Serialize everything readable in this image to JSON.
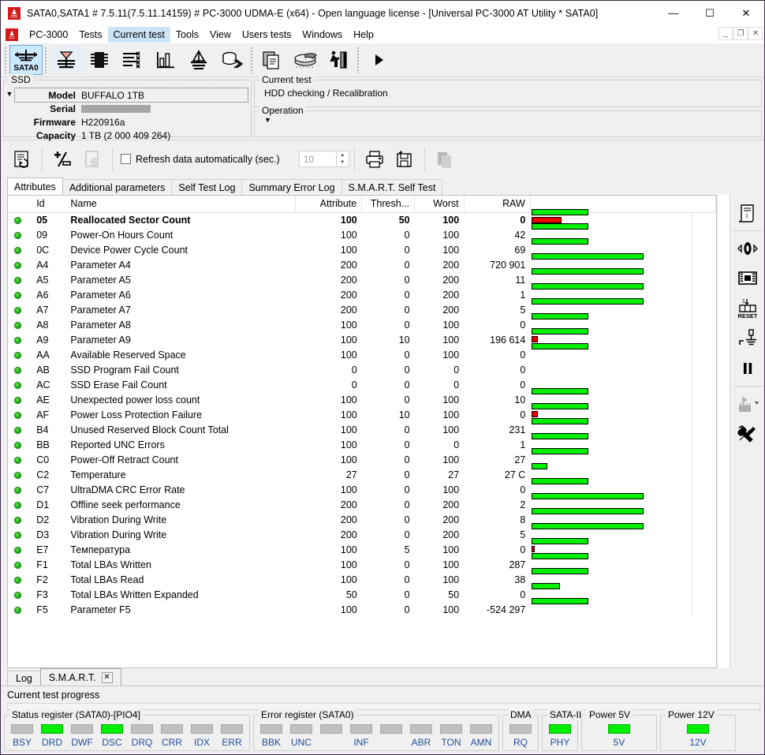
{
  "window": {
    "title": "SATA0,SATA1 # 7.5.11(7.5.11.14159) # PC-3000 UDMA-E (x64) - Open language license - [Universal PC-3000 AT Utility * SATA0]",
    "minimize": "—",
    "maximize": "☐",
    "close": "✕",
    "mdi_minimize": "_",
    "mdi_restore": "❐",
    "mdi_close": "✕"
  },
  "menu": {
    "items": [
      {
        "label": "PC-3000",
        "active": false
      },
      {
        "label": "Tests",
        "active": false
      },
      {
        "label": "Current test",
        "active": true
      },
      {
        "label": "Tools",
        "active": false
      },
      {
        "label": "View",
        "active": false
      },
      {
        "label": "Users tests",
        "active": false
      },
      {
        "label": "Windows",
        "active": false
      },
      {
        "label": "Help",
        "active": false
      }
    ]
  },
  "toolbar": {
    "port_label": "SATA0",
    "buttons": [
      {
        "name": "port-sata0-button",
        "state": "selected"
      },
      {
        "name": "drive-init-button",
        "state": "light"
      },
      {
        "name": "memory-chip-button",
        "state": "normal"
      },
      {
        "name": "list-tests-button",
        "state": "normal"
      },
      {
        "name": "chart-button",
        "state": "normal"
      },
      {
        "name": "heads-button",
        "state": "normal"
      },
      {
        "name": "disk-export-button",
        "state": "normal"
      },
      {
        "name": "copy-button",
        "state": "normal"
      },
      {
        "name": "platters-button",
        "state": "normal"
      },
      {
        "name": "run-person-button",
        "state": "normal"
      },
      {
        "name": "play-button",
        "state": "normal"
      }
    ]
  },
  "drive": {
    "group_label": "SSD",
    "fields": [
      {
        "label": "Model",
        "value": "BUFFALO 1TB",
        "redacted": false
      },
      {
        "label": "Serial",
        "value": "",
        "redacted": true
      },
      {
        "label": "Firmware",
        "value": "H220916a",
        "redacted": false
      },
      {
        "label": "Capacity",
        "value": "1 TB (2 000 409 264)",
        "redacted": false
      }
    ]
  },
  "current_test": {
    "group_label": "Current test",
    "value": "HDD checking / Recalibration"
  },
  "operation": {
    "group_label": "Operation",
    "value": ""
  },
  "panel_toolbar": {
    "refresh_checkbox_label": "Refresh data automatically (sec.)",
    "refresh_checked": false,
    "interval_value": "10",
    "buttons": [
      {
        "name": "refresh-smart-button"
      },
      {
        "name": "clear-smart-button"
      },
      {
        "name": "save-report-button"
      },
      {
        "name": "print-button"
      },
      {
        "name": "save-to-file-button"
      },
      {
        "name": "copy-table-button"
      }
    ]
  },
  "tabs": [
    {
      "label": "Attributes",
      "active": true
    },
    {
      "label": "Additional parameters",
      "active": false
    },
    {
      "label": "Self Test Log",
      "active": false
    },
    {
      "label": "Summary Error Log",
      "active": false
    },
    {
      "label": "S.M.A.R.T. Self Test",
      "active": false
    }
  ],
  "table": {
    "headers": [
      "",
      "Id",
      "Name",
      "Attribute",
      "Thresh...",
      "Worst",
      "RAW",
      ""
    ],
    "rows": [
      {
        "status": "ok",
        "id": "05",
        "name": "Reallocated Sector Count",
        "attribute": "100",
        "threshold": "50",
        "worst": "100",
        "raw": "0",
        "bold": true,
        "green_w": 72,
        "red_w": 38
      },
      {
        "status": "ok",
        "id": "09",
        "name": "Power-On Hours Count",
        "attribute": "100",
        "threshold": "0",
        "worst": "100",
        "raw": "42",
        "bold": false,
        "green_w": 72,
        "red_w": 0
      },
      {
        "status": "ok",
        "id": "0C",
        "name": "Device Power Cycle Count",
        "attribute": "100",
        "threshold": "0",
        "worst": "100",
        "raw": "69",
        "bold": false,
        "green_w": 72,
        "red_w": 0
      },
      {
        "status": "ok",
        "id": "A4",
        "name": "Parameter A4",
        "attribute": "200",
        "threshold": "0",
        "worst": "200",
        "raw": "720 901",
        "bold": false,
        "green_w": 142,
        "red_w": 0
      },
      {
        "status": "ok",
        "id": "A5",
        "name": "Parameter A5",
        "attribute": "200",
        "threshold": "0",
        "worst": "200",
        "raw": "11",
        "bold": false,
        "green_w": 142,
        "red_w": 0
      },
      {
        "status": "ok",
        "id": "A6",
        "name": "Parameter A6",
        "attribute": "200",
        "threshold": "0",
        "worst": "200",
        "raw": "1",
        "bold": false,
        "green_w": 142,
        "red_w": 0
      },
      {
        "status": "ok",
        "id": "A7",
        "name": "Parameter A7",
        "attribute": "200",
        "threshold": "0",
        "worst": "200",
        "raw": "5",
        "bold": false,
        "green_w": 142,
        "red_w": 0
      },
      {
        "status": "ok",
        "id": "A8",
        "name": "Parameter A8",
        "attribute": "100",
        "threshold": "0",
        "worst": "100",
        "raw": "0",
        "bold": false,
        "green_w": 72,
        "red_w": 0
      },
      {
        "status": "ok",
        "id": "A9",
        "name": "Parameter A9",
        "attribute": "100",
        "threshold": "10",
        "worst": "100",
        "raw": "196 614",
        "bold": false,
        "green_w": 72,
        "red_w": 8
      },
      {
        "status": "ok",
        "id": "AA",
        "name": "Available Reserved Space",
        "attribute": "100",
        "threshold": "0",
        "worst": "100",
        "raw": "0",
        "bold": false,
        "green_w": 72,
        "red_w": 0
      },
      {
        "status": "ok",
        "id": "AB",
        "name": "SSD Program Fail Count",
        "attribute": "0",
        "threshold": "0",
        "worst": "0",
        "raw": "0",
        "bold": false,
        "green_w": 0,
        "red_w": 0
      },
      {
        "status": "ok",
        "id": "AC",
        "name": "SSD Erase Fail Count",
        "attribute": "0",
        "threshold": "0",
        "worst": "0",
        "raw": "0",
        "bold": false,
        "green_w": 0,
        "red_w": 0
      },
      {
        "status": "ok",
        "id": "AE",
        "name": "Unexpected power loss count",
        "attribute": "100",
        "threshold": "0",
        "worst": "100",
        "raw": "10",
        "bold": false,
        "green_w": 72,
        "red_w": 0
      },
      {
        "status": "ok",
        "id": "AF",
        "name": "Power Loss Protection Failure",
        "attribute": "100",
        "threshold": "10",
        "worst": "100",
        "raw": "0",
        "bold": false,
        "green_w": 72,
        "red_w": 8
      },
      {
        "status": "ok",
        "id": "B4",
        "name": "Unused Reserved Block Count Total",
        "attribute": "100",
        "threshold": "0",
        "worst": "100",
        "raw": "231",
        "bold": false,
        "green_w": 72,
        "red_w": 0
      },
      {
        "status": "ok",
        "id": "BB",
        "name": "Reported UNC Errors",
        "attribute": "100",
        "threshold": "0",
        "worst": "0",
        "raw": "1",
        "bold": false,
        "green_w": 72,
        "red_w": 0
      },
      {
        "status": "ok",
        "id": "C0",
        "name": "Power-Off Retract Count",
        "attribute": "100",
        "threshold": "0",
        "worst": "100",
        "raw": "27",
        "bold": false,
        "green_w": 72,
        "red_w": 0
      },
      {
        "status": "ok",
        "id": "C2",
        "name": "Temperature",
        "attribute": "27",
        "threshold": "0",
        "worst": "27",
        "raw": "27 C",
        "bold": false,
        "green_w": 20,
        "red_w": 0
      },
      {
        "status": "ok",
        "id": "C7",
        "name": "UltraDMA CRC Error Rate",
        "attribute": "100",
        "threshold": "0",
        "worst": "100",
        "raw": "0",
        "bold": false,
        "green_w": 72,
        "red_w": 0
      },
      {
        "status": "ok",
        "id": "D1",
        "name": "Offline seek performance",
        "attribute": "200",
        "threshold": "0",
        "worst": "200",
        "raw": "2",
        "bold": false,
        "green_w": 142,
        "red_w": 0
      },
      {
        "status": "ok",
        "id": "D2",
        "name": "Vibration During Write",
        "attribute": "200",
        "threshold": "0",
        "worst": "200",
        "raw": "8",
        "bold": false,
        "green_w": 142,
        "red_w": 0
      },
      {
        "status": "ok",
        "id": "D3",
        "name": "Vibration During Write",
        "attribute": "200",
        "threshold": "0",
        "worst": "200",
        "raw": "5",
        "bold": false,
        "green_w": 142,
        "red_w": 0
      },
      {
        "status": "ok",
        "id": "E7",
        "name": "Температура",
        "attribute": "100",
        "threshold": "5",
        "worst": "100",
        "raw": "0",
        "bold": false,
        "green_w": 72,
        "red_w": 4
      },
      {
        "status": "ok",
        "id": "F1",
        "name": "Total LBAs Written",
        "attribute": "100",
        "threshold": "0",
        "worst": "100",
        "raw": "287",
        "bold": false,
        "green_w": 72,
        "red_w": 0
      },
      {
        "status": "ok",
        "id": "F2",
        "name": "Total LBAs Read",
        "attribute": "100",
        "threshold": "0",
        "worst": "100",
        "raw": "38",
        "bold": false,
        "green_w": 72,
        "red_w": 0
      },
      {
        "status": "ok",
        "id": "F3",
        "name": "Total LBAs Written Expanded",
        "attribute": "50",
        "threshold": "0",
        "worst": "50",
        "raw": "0",
        "bold": false,
        "green_w": 36,
        "red_w": 0
      },
      {
        "status": "ok",
        "id": "F5",
        "name": "Parameter F5",
        "attribute": "100",
        "threshold": "0",
        "worst": "100",
        "raw": "-524 297",
        "bold": false,
        "green_w": 72,
        "red_w": 0
      }
    ]
  },
  "right_toolbar": {
    "buttons": [
      {
        "name": "log-info-icon"
      },
      {
        "name": "power-toggle-icon"
      },
      {
        "name": "pcb-board-icon"
      },
      {
        "name": "counter-reset-icon"
      },
      {
        "name": "signal-probe-icon"
      },
      {
        "name": "pause-icon"
      },
      {
        "name": "run-chip-icon"
      },
      {
        "name": "tools-icon"
      }
    ]
  },
  "bottom_tabs": [
    {
      "label": "Log",
      "active": false,
      "closable": false
    },
    {
      "label": "S.M.A.R.T.",
      "active": true,
      "closable": true,
      "close_glyph": "✕"
    }
  ],
  "progress": {
    "label": "Current test progress",
    "percent": 0
  },
  "registers": {
    "status": {
      "legend": "Status register (SATA0)-[PIO4]",
      "leds": [
        {
          "name": "BSY",
          "on": false
        },
        {
          "name": "DRD",
          "on": true
        },
        {
          "name": "DWF",
          "on": false
        },
        {
          "name": "DSC",
          "on": true
        },
        {
          "name": "DRQ",
          "on": false
        },
        {
          "name": "CRR",
          "on": false
        },
        {
          "name": "IDX",
          "on": false
        },
        {
          "name": "ERR",
          "on": false
        }
      ]
    },
    "error": {
      "legend": "Error register (SATA0)",
      "leds": [
        {
          "name": "BBK",
          "on": false
        },
        {
          "name": "UNC",
          "on": false
        },
        {
          "name": "",
          "on": false
        },
        {
          "name": "INF",
          "on": false
        },
        {
          "name": "",
          "on": false
        },
        {
          "name": "ABR",
          "on": false
        },
        {
          "name": "TON",
          "on": false
        },
        {
          "name": "AMN",
          "on": false
        }
      ]
    },
    "dma": {
      "legend": "DMA",
      "leds": [
        {
          "name": "RQ",
          "on": false
        }
      ]
    },
    "sata": {
      "legend": "SATA-II",
      "leds": [
        {
          "name": "PHY",
          "on": true
        }
      ]
    },
    "power5": {
      "legend": "Power 5V",
      "leds": [
        {
          "name": "5V",
          "on": true
        }
      ]
    },
    "power12": {
      "legend": "Power 12V",
      "leds": [
        {
          "name": "12V",
          "on": true
        }
      ]
    }
  },
  "colors": {
    "accent": "#cce4f7",
    "led_on": "#00ee00",
    "led_off": "#c0c0c0",
    "bar_green": "#00ee00",
    "bar_red": "#ee0000",
    "reg_label": "#1f4e9c"
  }
}
